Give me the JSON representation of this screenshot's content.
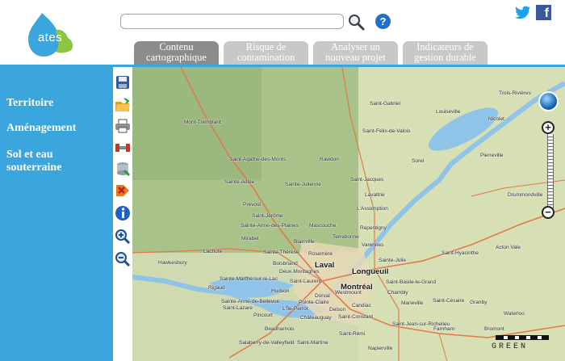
{
  "header": {
    "logo_text": "ates",
    "search": {
      "value": "",
      "placeholder": ""
    },
    "icons": [
      "search-icon",
      "help-icon",
      "twitter-icon",
      "facebook-icon"
    ],
    "facebook_glyph": "f",
    "help_glyph": "?"
  },
  "tabs": [
    {
      "label": "Contenu cartographique",
      "active": true
    },
    {
      "label": "Risque de contamination",
      "active": false
    },
    {
      "label": "Analyser un nouveau projet",
      "active": false
    },
    {
      "label": "Indicateurs de gestion durable",
      "active": false
    }
  ],
  "sidebar": {
    "items": [
      {
        "label": "Territoire"
      },
      {
        "label": "Aménagement"
      },
      {
        "label": "Sol et eau souterraine"
      }
    ]
  },
  "tools": [
    "save-icon",
    "open-folder-icon",
    "print-icon",
    "measure-icon",
    "layers-icon",
    "clear-icon",
    "info-icon",
    "zoom-in-icon",
    "zoom-out-icon"
  ],
  "map": {
    "zoom_in": "+",
    "zoom_out": "−",
    "credit": "GREEN",
    "places": [
      "Trois-Rivières",
      "Saint-Gabriel",
      "Louiseville",
      "Nicolet",
      "Mont-Tremblant",
      "Saint-Félix-de-Valois",
      "Sorel",
      "Pierreville",
      "Rawdon",
      "Saint-Agathe-des-Monts",
      "Saint-Jacques",
      "Sainte-Adèle",
      "Sainte-Julienne",
      "Drummondville",
      "Lavaltrie",
      "Prévost",
      "L'Assomption",
      "Saint-Jérôme",
      "Mascouche",
      "Repentigny",
      "Sainte-Anne-des-Plaines",
      "Terrebonne",
      "Mirabel",
      "Blainville",
      "Varennes",
      "Acton Vale",
      "Lachute",
      "Sainte-Thérèse",
      "Rosemère",
      "Saint-Hyacinthe",
      "Hawkesbury",
      "Boisbriand",
      "Laval",
      "Longueuil",
      "Sainte-Julie",
      "Deux-Montagnes",
      "Sainte-Marthe-sur-le-Lac",
      "Saint-Laurent",
      "Montréal",
      "Saint-Basile-le-Grand",
      "Rigaud",
      "Hudson",
      "Dorval",
      "Westmount",
      "Chambly",
      "Granby",
      "Sainte-Anne-de-Bellevue",
      "Pointe-Claire",
      "Marieville",
      "Saint-Césaire",
      "Saint-Lazare",
      "L'Île-Perrot",
      "Delson",
      "Candiac",
      "Waterloo",
      "Pincourt",
      "Saint-Constant",
      "Beauharnois",
      "Châteauguay",
      "Saint-Jean-sur-Richelieu",
      "Bromont",
      "Farnham",
      "Saint-Rémi",
      "Salaberry-de-Valleyfield",
      "Napierville",
      "Saint-Martine"
    ]
  }
}
